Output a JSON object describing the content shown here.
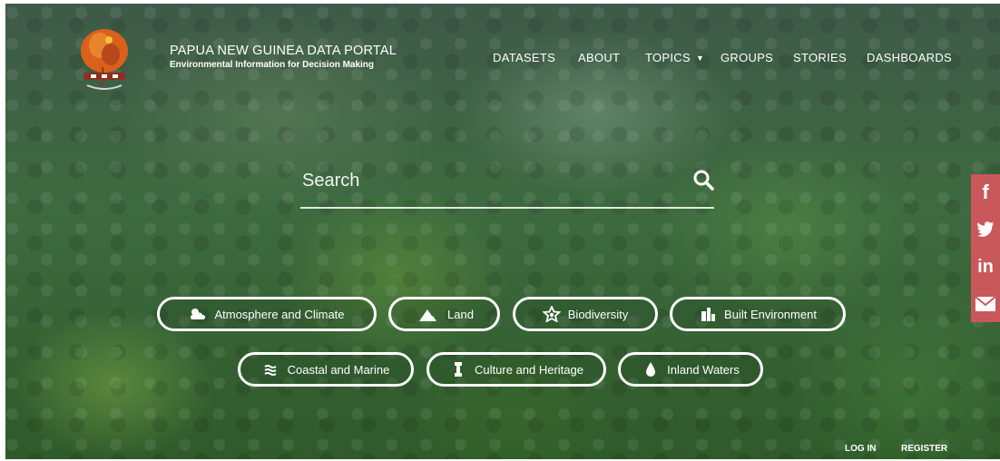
{
  "brand": {
    "title": "PAPUA NEW GUINEA DATA PORTAL",
    "subtitle": "Environmental Information for Decision Making"
  },
  "nav": {
    "datasets": "DATASETS",
    "about": "ABOUT",
    "topics": "TOPICS",
    "groups": "GROUPS",
    "stories": "STORIES",
    "dashboards": "DASHBOARDS"
  },
  "search": {
    "placeholder": "Search"
  },
  "categories": {
    "atmosphere": "Atmosphere and Climate",
    "land": "Land",
    "biodiversity": "Biodiversity",
    "built": "Built Environment",
    "coastal": "Coastal and Marine",
    "culture": "Culture and Heritage",
    "inland": "Inland Waters"
  },
  "social": {
    "facebook": "f",
    "twitter": "twitter-icon",
    "linkedin": "in",
    "email": "envelope-icon",
    "bar_color": "#c8585a"
  },
  "footer": {
    "login": "LOG IN",
    "register": "REGISTER"
  }
}
